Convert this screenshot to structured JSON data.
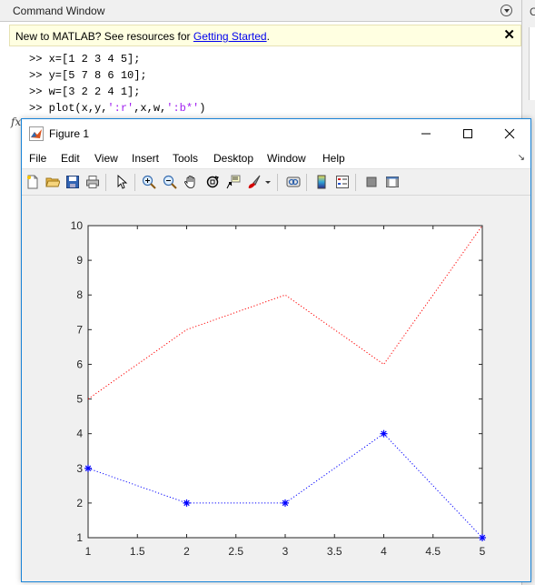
{
  "command_window": {
    "title": "Command Window",
    "notice": {
      "text": "New to MATLAB? See resources for ",
      "link": "Getting Started",
      "suffix": "."
    },
    "lines": [
      {
        "prompt": ">> ",
        "code": "x=[1 2 3 4 5];",
        "string": "",
        "tail": ""
      },
      {
        "prompt": ">> ",
        "code": "y=[5 7 8 6 10];",
        "string": "",
        "tail": ""
      },
      {
        "prompt": ">> ",
        "code": "w=[3 2 2 4 1];",
        "string": "",
        "tail": ""
      },
      {
        "prompt": ">> ",
        "code": "plot(x,y,",
        "string": "':r'",
        "mid": ",x,w,",
        "string2": "':b*'",
        "tail": ")"
      }
    ],
    "fx": "fx",
    "right_panel_label": "C"
  },
  "figure": {
    "title": "Figure 1",
    "menu": [
      "File",
      "Edit",
      "View",
      "Insert",
      "Tools",
      "Desktop",
      "Window",
      "Help"
    ],
    "toolbar": [
      "new-figure-icon",
      "open-file-icon",
      "save-icon",
      "print-icon",
      "select-arrow-icon",
      "zoom-in-icon",
      "zoom-out-icon",
      "pan-hand-icon",
      "rotate-3d-icon",
      "data-cursor-icon",
      "brush-icon",
      "link-plot-icon",
      "insert-colorbar-icon",
      "insert-legend-icon",
      "hide-plot-tools-icon",
      "show-plot-tools-icon"
    ],
    "menu_arrow": "↘"
  },
  "chart_data": {
    "type": "line",
    "x": [
      1,
      2,
      3,
      4,
      5
    ],
    "series": [
      {
        "values": [
          5,
          7,
          8,
          6,
          10
        ],
        "color": "#ff0000",
        "linestyle": "dotted",
        "marker": ""
      },
      {
        "values": [
          3,
          2,
          2,
          4,
          1
        ],
        "color": "#0000ff",
        "linestyle": "dotted",
        "marker": "*"
      }
    ],
    "xlim": [
      1,
      5
    ],
    "ylim": [
      1,
      10
    ],
    "xticks": [
      1,
      1.5,
      2,
      2.5,
      3,
      3.5,
      4,
      4.5,
      5
    ],
    "xtick_labels": [
      "1",
      "1.5",
      "2",
      "2.5",
      "3",
      "3.5",
      "4",
      "4.5",
      "5"
    ],
    "yticks": [
      1,
      2,
      3,
      4,
      5,
      6,
      7,
      8,
      9,
      10
    ],
    "ytick_labels": [
      "1",
      "2",
      "3",
      "4",
      "5",
      "6",
      "7",
      "8",
      "9",
      "10"
    ],
    "title": "",
    "xlabel": "",
    "ylabel": "",
    "grid": false
  }
}
